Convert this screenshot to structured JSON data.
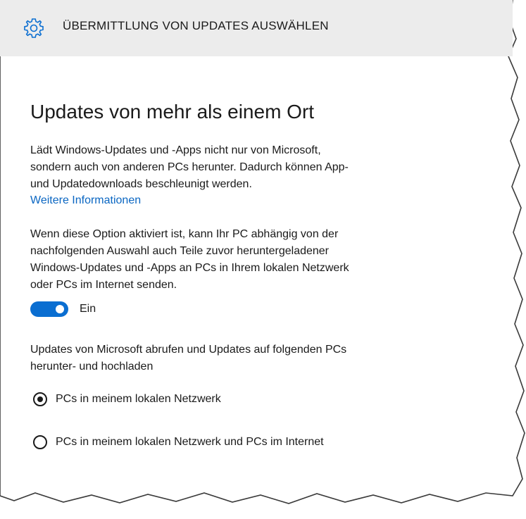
{
  "header": {
    "icon": "gear-icon",
    "title": "ÜBERMITTLUNG VON UPDATES AUSWÄHLEN"
  },
  "main": {
    "heading": "Updates von mehr als einem Ort",
    "description_lines": [
      "Lädt Windows-Updates und -Apps nicht nur von Microsoft,",
      "sondern auch von anderen PCs herunter. Dadurch können App-",
      "und Updatedownloads beschleunigt werden."
    ],
    "more_info_link": "Weitere Informationen",
    "option_info_lines": [
      "Wenn diese Option aktiviert ist, kann Ihr PC abhängig von der",
      "nachfolgenden Auswahl auch Teile zuvor heruntergeladener",
      "Windows-Updates und -Apps an PCs in Ihrem lokalen Netzwerk",
      "oder PCs im Internet senden."
    ],
    "toggle": {
      "state": "on",
      "label": "Ein"
    },
    "source_prompt_lines": [
      "Updates von Microsoft abrufen und Updates auf folgenden PCs",
      "herunter- und hochladen"
    ],
    "radio_options": [
      {
        "label": "PCs in meinem lokalen Netzwerk",
        "selected": true
      },
      {
        "label": "PCs in meinem lokalen Netzwerk und PCs im Internet",
        "selected": false
      }
    ]
  },
  "colors": {
    "accent": "#0a6ed1",
    "link": "#0a66c2",
    "title_bar": "#ececec"
  }
}
